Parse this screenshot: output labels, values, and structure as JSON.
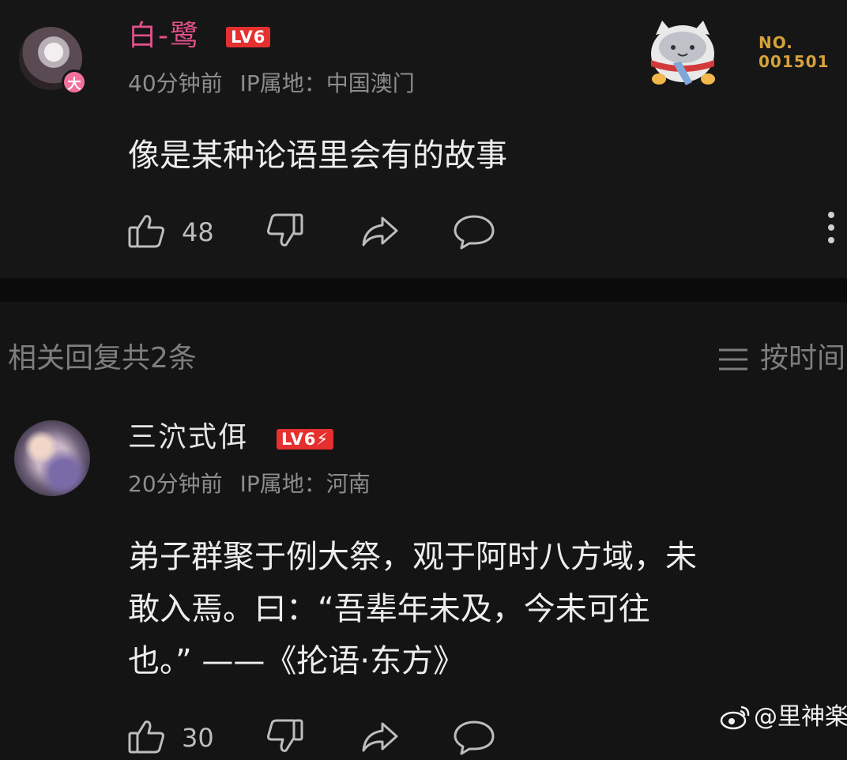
{
  "comment": {
    "username": "白-鹭",
    "level": "LV6",
    "avatar_badge": "大",
    "time": "40分钟前",
    "ip_label": "IP属地：中国澳门",
    "text": "像是某种论语里会有的故事",
    "like_count": "48",
    "number_badge_line1": "NO.",
    "number_badge_line2": "001501"
  },
  "replies_header": {
    "title": "相关回复共2条",
    "sort_label": "按时间"
  },
  "reply": {
    "username": "三泬式佴",
    "level": "LV6⚡",
    "time": "20分钟前",
    "ip_label": "IP属地：河南",
    "text_lines": [
      "弟子群聚于例大祭，观于阿时八方域，未",
      "敢入焉。曰：“吾辈年未及，今未可往",
      "也。” ——《抡语·东方》"
    ],
    "like_count": "30"
  },
  "watermark": "@里神楽",
  "icons": {
    "like": "thumbs-up-icon",
    "dislike": "thumbs-down-icon",
    "share": "share-icon",
    "reply": "comment-icon",
    "more": "more-vertical-icon",
    "sort": "sort-lines-icon",
    "weibo": "weibo-icon"
  },
  "colors": {
    "background": "#141414",
    "username_pink": "#e4508a",
    "level_badge": "#e53030",
    "meta_gray": "#8d8d8d",
    "number_badge": "#d6a23a"
  }
}
